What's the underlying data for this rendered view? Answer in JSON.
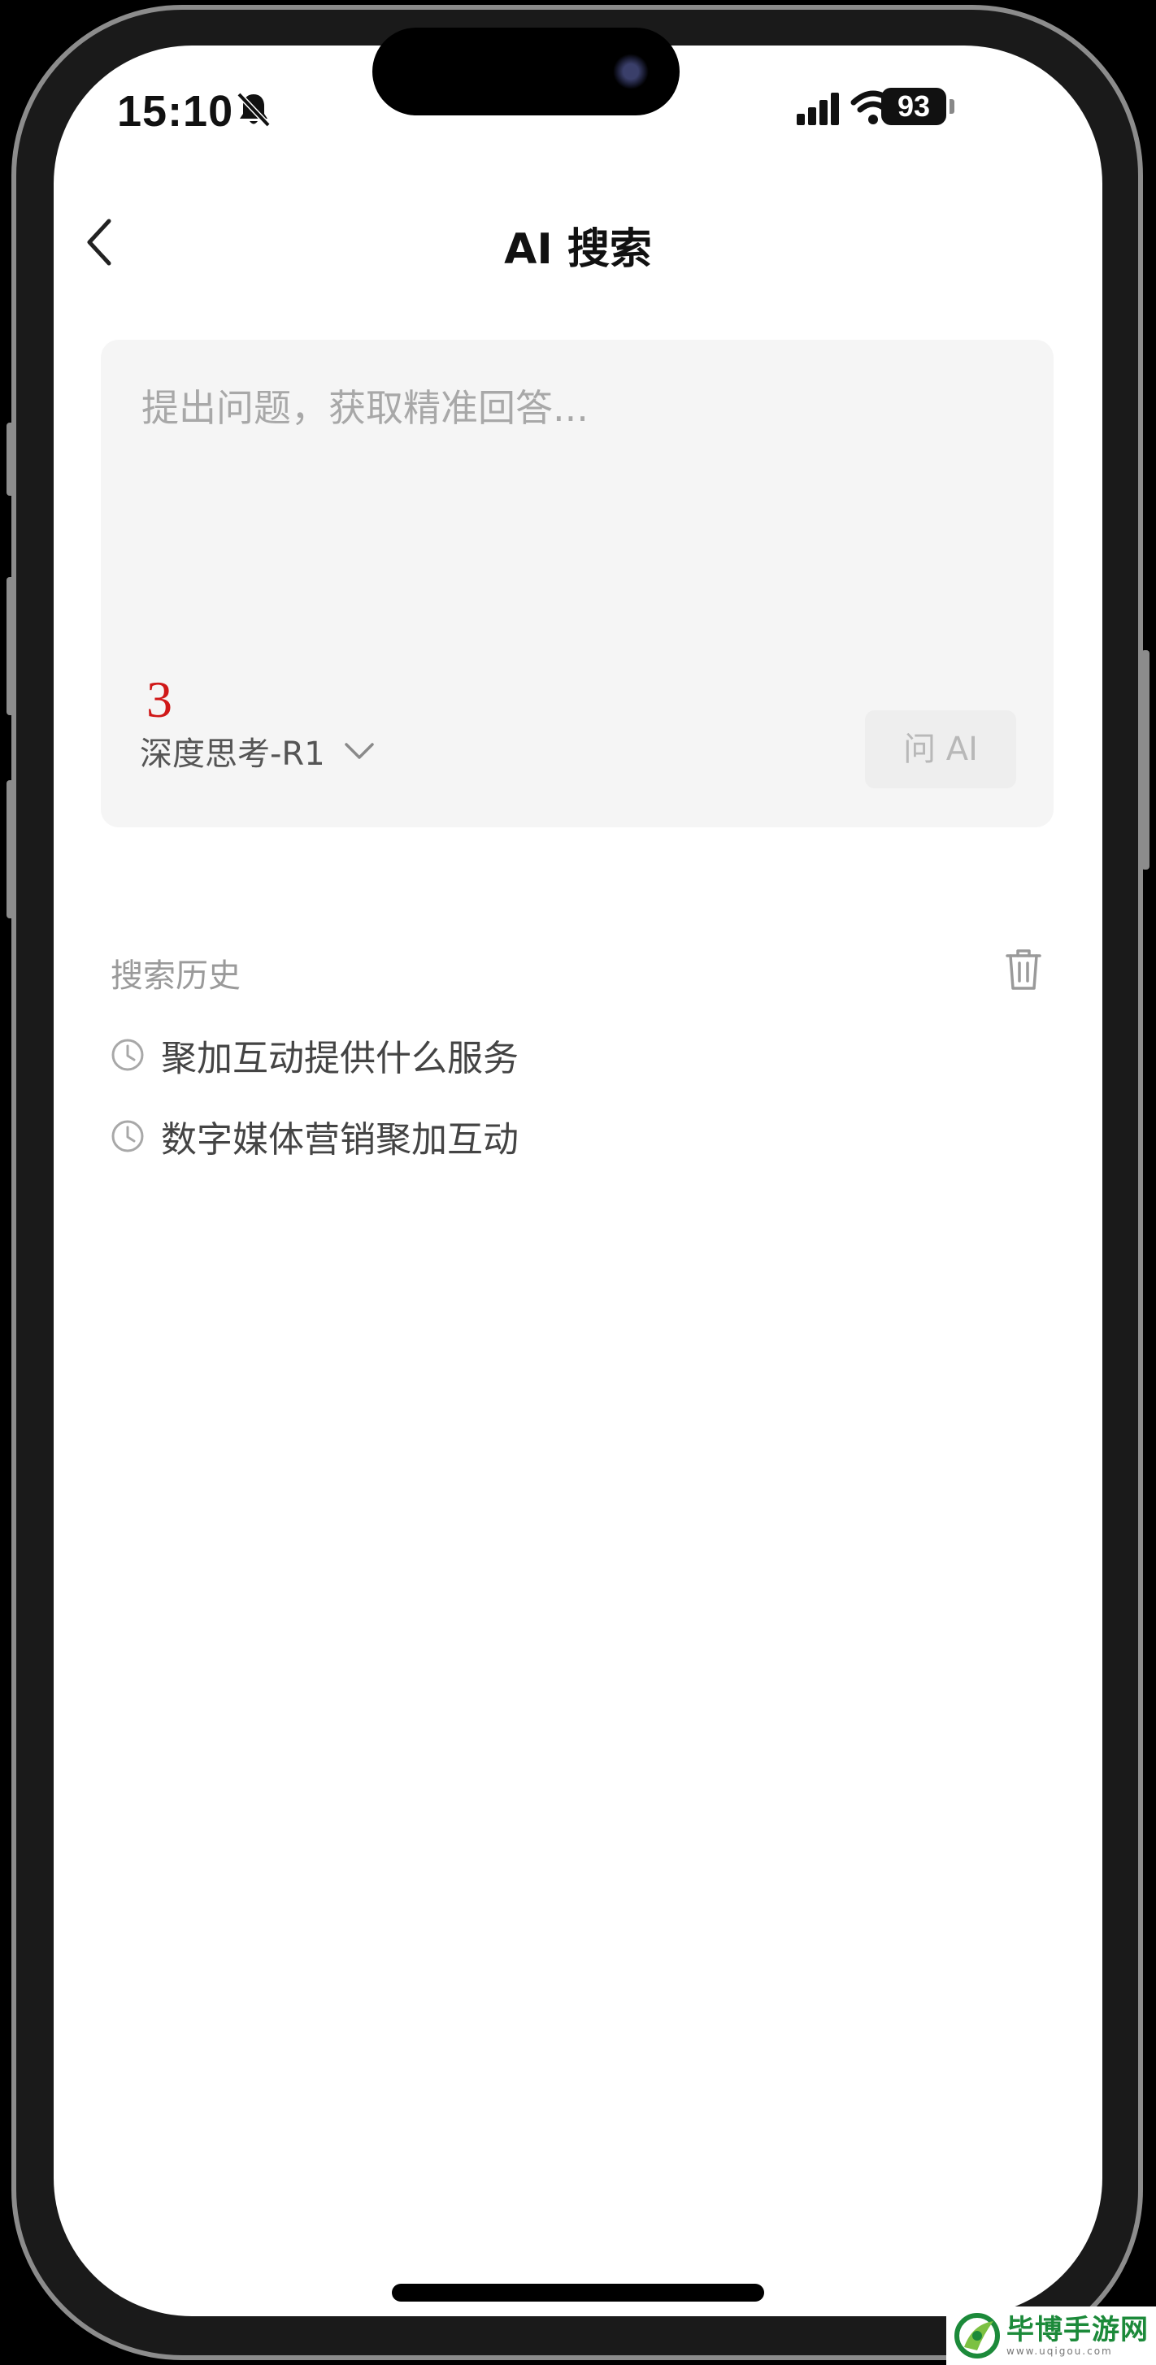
{
  "status_bar": {
    "time": "15:10",
    "battery": "93",
    "icons": [
      "bell-slash-icon",
      "signal-icon",
      "wifi-icon",
      "battery-icon"
    ]
  },
  "nav": {
    "title": "AI 搜索",
    "back_icon": "chevron-left-icon"
  },
  "input": {
    "placeholder": "提出问题，获取精准回答...",
    "annotation": "3",
    "model_label": "深度思考-R1",
    "ask_button": "问 AI"
  },
  "history": {
    "title": "搜索历史",
    "items": [
      {
        "text": "聚加互动提供什么服务",
        "icon": "clock-icon"
      },
      {
        "text": "数字媒体营销聚加互动",
        "icon": "clock-icon"
      }
    ]
  },
  "watermark": {
    "title": "毕博手游网",
    "sub": "www.uqigou.com"
  },
  "colors": {
    "card_bg": "#f5f5f5",
    "annotation": "#d01818",
    "placeholder": "#a8a8a8",
    "watermark_green": "#1c8a3a"
  }
}
